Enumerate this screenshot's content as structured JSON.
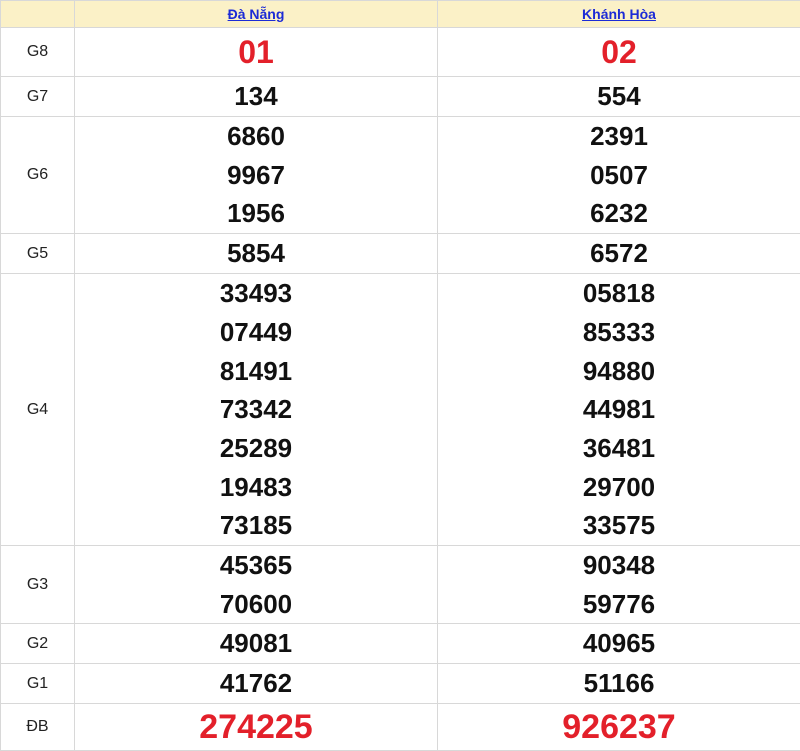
{
  "columns": [
    "Đà Nẵng",
    "Khánh Hòa"
  ],
  "prizes": {
    "g8": {
      "label": "G8",
      "values": [
        [
          "01"
        ],
        [
          "02"
        ]
      ]
    },
    "g7": {
      "label": "G7",
      "values": [
        [
          "134"
        ],
        [
          "554"
        ]
      ]
    },
    "g6": {
      "label": "G6",
      "values": [
        [
          "6860",
          "9967",
          "1956"
        ],
        [
          "2391",
          "0507",
          "6232"
        ]
      ]
    },
    "g5": {
      "label": "G5",
      "values": [
        [
          "5854"
        ],
        [
          "6572"
        ]
      ]
    },
    "g4": {
      "label": "G4",
      "values": [
        [
          "33493",
          "07449",
          "81491",
          "73342",
          "25289",
          "19483",
          "73185"
        ],
        [
          "05818",
          "85333",
          "94880",
          "44981",
          "36481",
          "29700",
          "33575"
        ]
      ]
    },
    "g3": {
      "label": "G3",
      "values": [
        [
          "45365",
          "70600"
        ],
        [
          "90348",
          "59776"
        ]
      ]
    },
    "g2": {
      "label": "G2",
      "values": [
        [
          "49081"
        ],
        [
          "40965"
        ]
      ]
    },
    "g1": {
      "label": "G1",
      "values": [
        [
          "41762"
        ],
        [
          "51166"
        ]
      ]
    },
    "db": {
      "label": "ĐB",
      "values": [
        [
          "274225"
        ],
        [
          "926237"
        ]
      ]
    }
  },
  "colors": {
    "header_bg": "#fbf1c7",
    "link": "#1c2bd6",
    "highlight": "#e3202a"
  }
}
